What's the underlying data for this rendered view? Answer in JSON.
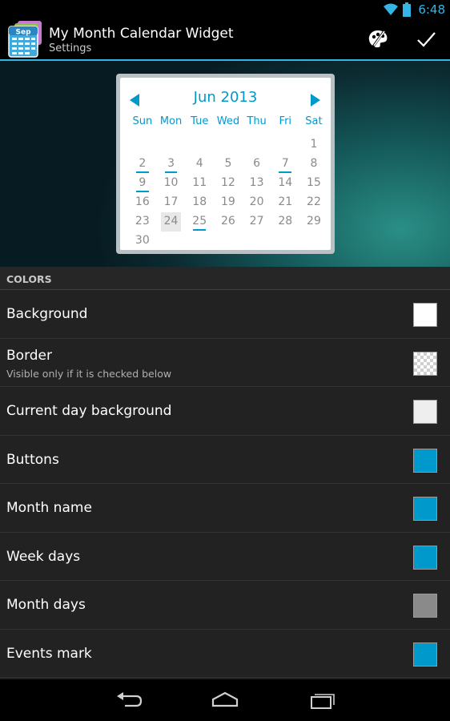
{
  "status_bar": {
    "time": "6:48",
    "icons": [
      "wifi-icon",
      "battery-icon"
    ]
  },
  "action_bar": {
    "app_icon_text": "Sep",
    "title": "My Month Calendar Widget",
    "subtitle": "Settings",
    "actions": [
      "palette-icon",
      "check-icon"
    ]
  },
  "widget": {
    "month_label": "Jun 2013",
    "weekdays": [
      "Sun",
      "Mon",
      "Tue",
      "Wed",
      "Thu",
      "Fri",
      "Sat"
    ],
    "days": [
      {
        "label": ""
      },
      {
        "label": ""
      },
      {
        "label": ""
      },
      {
        "label": ""
      },
      {
        "label": ""
      },
      {
        "label": ""
      },
      {
        "label": "1"
      },
      {
        "label": "2",
        "event": true
      },
      {
        "label": "3",
        "event": true
      },
      {
        "label": "4"
      },
      {
        "label": "5"
      },
      {
        "label": "6"
      },
      {
        "label": "7",
        "event": true
      },
      {
        "label": "8"
      },
      {
        "label": "9",
        "event": true
      },
      {
        "label": "10"
      },
      {
        "label": "11"
      },
      {
        "label": "12"
      },
      {
        "label": "13"
      },
      {
        "label": "14"
      },
      {
        "label": "15"
      },
      {
        "label": "16"
      },
      {
        "label": "17"
      },
      {
        "label": "18"
      },
      {
        "label": "19"
      },
      {
        "label": "20"
      },
      {
        "label": "21"
      },
      {
        "label": "22"
      },
      {
        "label": "23"
      },
      {
        "label": "24",
        "today": true
      },
      {
        "label": "25",
        "event": true
      },
      {
        "label": "26"
      },
      {
        "label": "27"
      },
      {
        "label": "28"
      },
      {
        "label": "29"
      },
      {
        "label": "30"
      }
    ]
  },
  "settings": {
    "section_title": "COLORS",
    "items": [
      {
        "title": "Background",
        "summary": "",
        "color": "#ffffff",
        "pattern": ""
      },
      {
        "title": "Border",
        "summary": "Visible only if it is checked below",
        "color": "#ffffff",
        "pattern": "checker"
      },
      {
        "title": "Current day background",
        "summary": "",
        "color": "#eeeeee",
        "pattern": ""
      },
      {
        "title": "Buttons",
        "summary": "",
        "color": "#0099cc",
        "pattern": ""
      },
      {
        "title": "Month name",
        "summary": "",
        "color": "#0099cc",
        "pattern": ""
      },
      {
        "title": "Week days",
        "summary": "",
        "color": "#0099cc",
        "pattern": ""
      },
      {
        "title": "Month days",
        "summary": "",
        "color": "#8a8a8a",
        "pattern": ""
      },
      {
        "title": "Events mark",
        "summary": "",
        "color": "#0099cc",
        "pattern": ""
      }
    ]
  },
  "nav_bar": {
    "buttons": [
      "back-icon",
      "home-icon",
      "recent-apps-icon"
    ]
  },
  "colors": {
    "accent": "#33b5e5",
    "widget_blue": "#0099cc",
    "list_bg": "#222222"
  }
}
